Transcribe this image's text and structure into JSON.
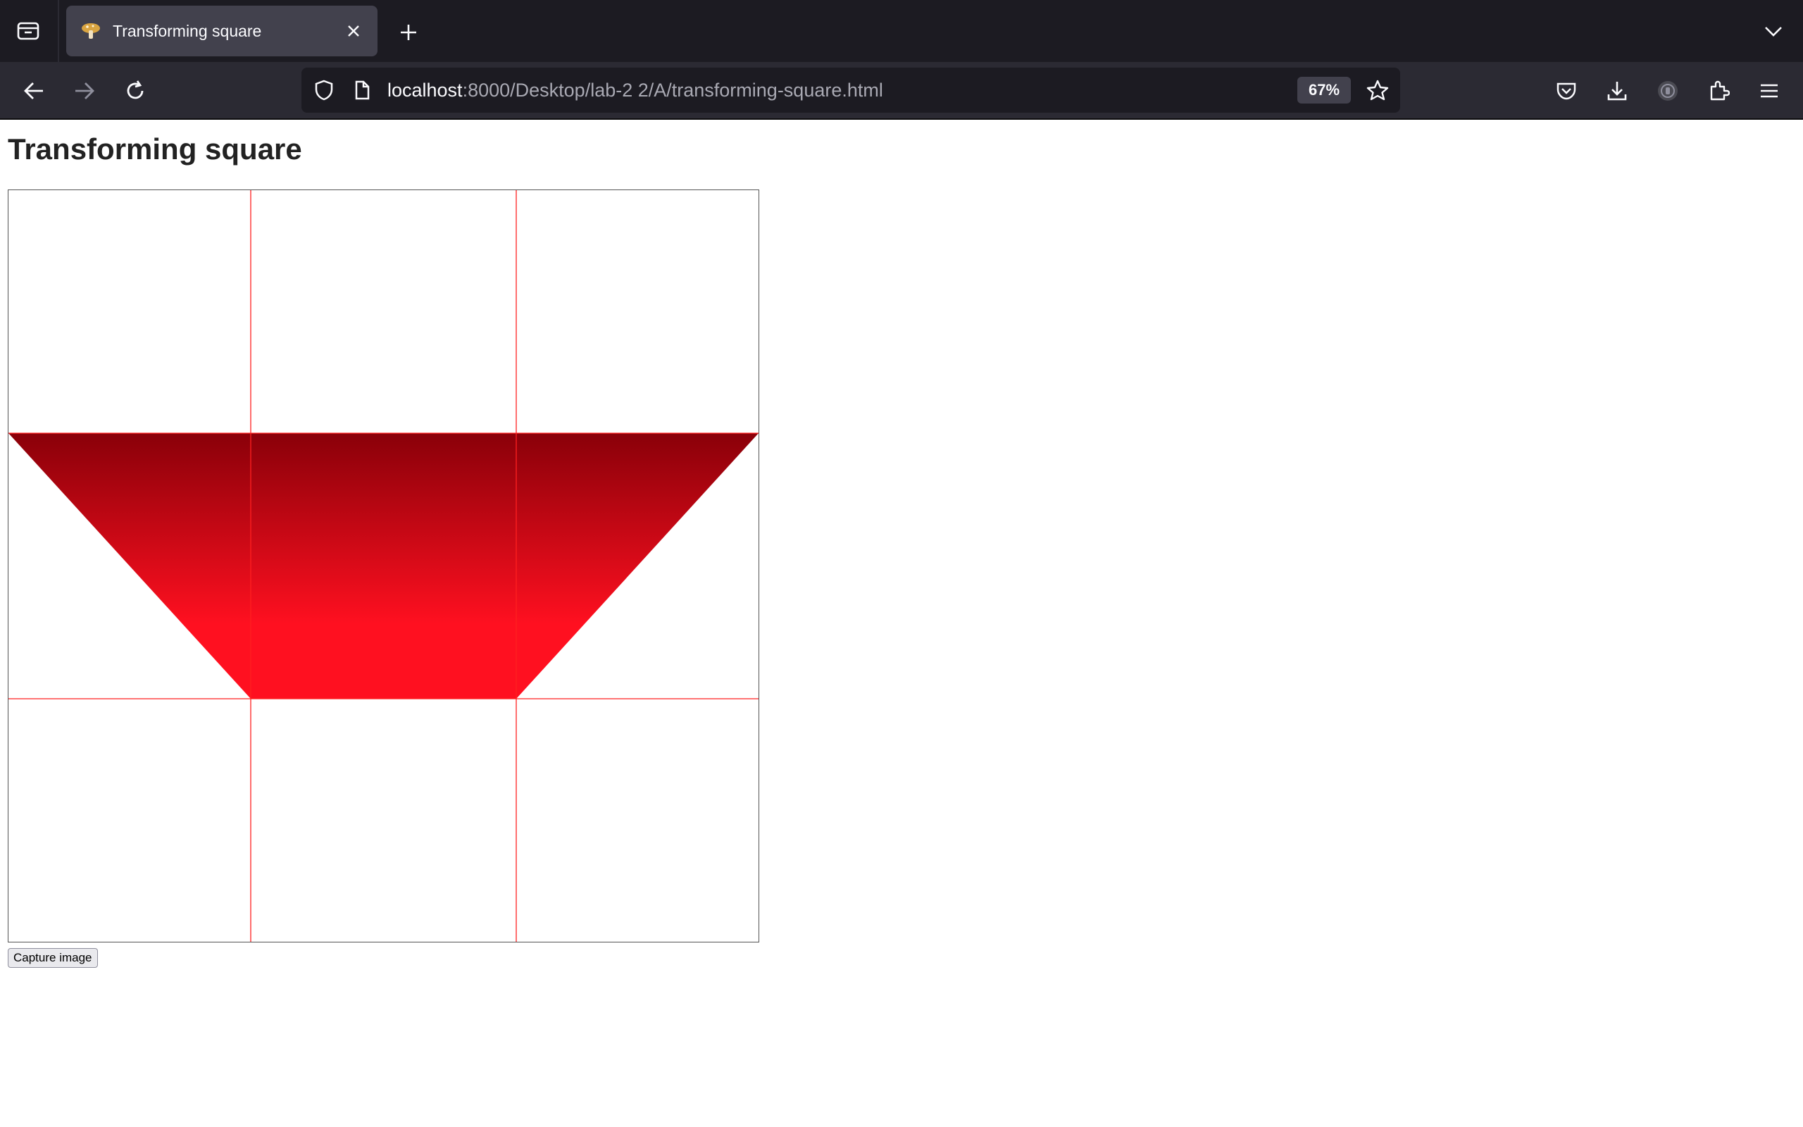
{
  "browser": {
    "tab_title": "Transforming square",
    "url_host": "localhost",
    "url_rest": ":8000/Desktop/lab-2 2/A/transforming-square.html",
    "zoom": "67%",
    "icons": {
      "tab_view": "tab-view-icon",
      "favicon": "mushroom-icon",
      "tab_close": "close-icon",
      "new_tab": "plus-icon",
      "tab_list": "chevron-down-icon",
      "back": "back-arrow-icon",
      "forward": "forward-arrow-icon",
      "reload": "reload-icon",
      "tracking": "shield-icon",
      "page_info": "page-icon",
      "bookmark": "star-icon",
      "pocket": "pocket-icon",
      "downloads": "download-icon",
      "account": "account-icon",
      "extensions": "puzzle-icon",
      "menu": "hamburger-icon"
    }
  },
  "page": {
    "heading": "Transforming square",
    "capture_button": "Capture image"
  },
  "colors": {
    "grid_line": "#ff2020",
    "shape_top": "#8a0009",
    "shape_bottom": "#ff1020",
    "canvas_border": "#555555"
  }
}
